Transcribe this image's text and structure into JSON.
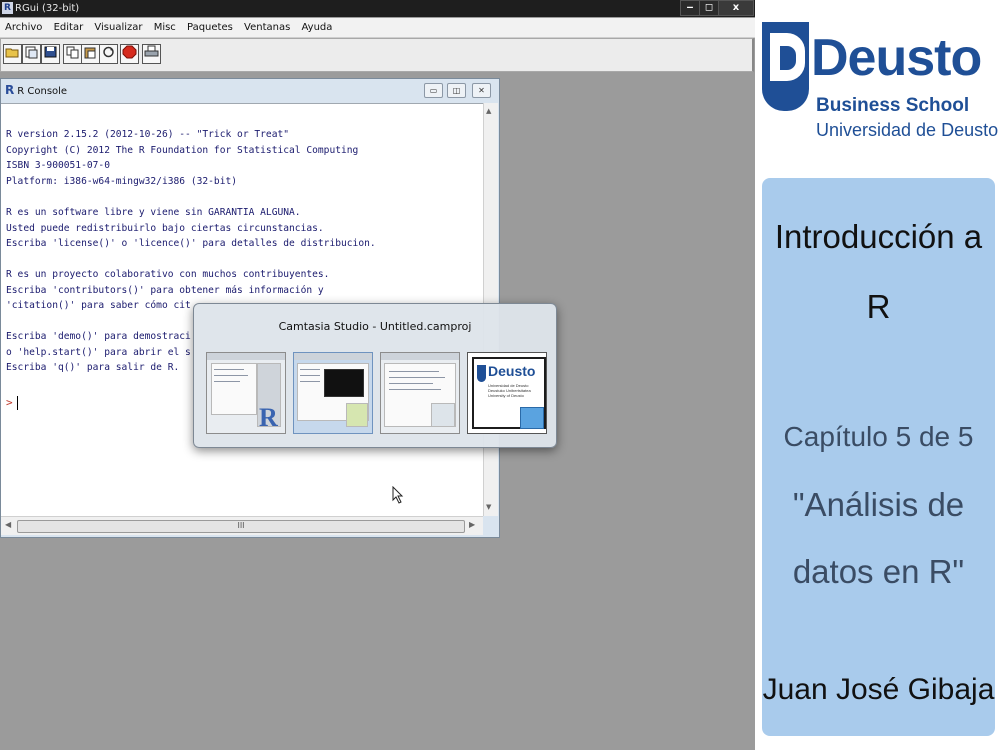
{
  "window": {
    "title": "RGui (32-bit)",
    "controls": [
      "‒",
      "◻",
      "x"
    ]
  },
  "menubar": {
    "items": [
      "Archivo",
      "Editar",
      "Visualizar",
      "Misc",
      "Paquetes",
      "Ventanas",
      "Ayuda"
    ]
  },
  "toolbar": {
    "buttons": [
      "open-script-icon",
      "load-workspace-icon",
      "save-workspace-icon",
      "copy-icon",
      "paste-icon",
      "copy-paste-icon",
      "stop-icon",
      "print-icon"
    ]
  },
  "console": {
    "title": "R Console",
    "lines_block1": "R version 2.15.2 (2012-10-26) -- \"Trick or Treat\"\nCopyright (C) 2012 The R Foundation for Statistical Computing\nISBN 3-900051-07-0\nPlatform: i386-w64-mingw32/i386 (32-bit)",
    "lines_block2": "R es un software libre y viene sin GARANTIA ALGUNA.\nUsted puede redistribuirlo bajo ciertas circunstancias.\nEscriba 'license()' o 'licence()' para detalles de distribucion.",
    "lines_block3": "R es un proyecto colaborativo con muchos contribuyentes.\nEscriba 'contributors()' para obtener más información y\n'citation()' para saber cómo cit",
    "lines_block4": "Escriba 'demo()' para demostraci\no 'help.start()' para abrir el s\nEscriba 'q()' para salir de R.",
    "prompt": ">",
    "hscroll_label": "III"
  },
  "switcher": {
    "title": "Camtasia Studio - Untitled.camproj",
    "thumbnail_labels": [
      "R",
      "",
      "",
      "Deusto"
    ],
    "deusto_thumb_caption": "Universidad de Deusto\nDeustuko Unibertsitatea\nUniversity of Deusto",
    "selected_index": 1
  },
  "slide": {
    "logo_word": "Deusto",
    "logo_school": "Business School",
    "logo_university": "Universidad de Deusto",
    "title_line1": "Introducción a",
    "title_line2": "R",
    "chapter": "Capítulo 5 de 5",
    "subtitle_line1": "\"Análisis de",
    "subtitle_line2": "datos en R\"",
    "author": "Juan José Gibaja"
  },
  "colors": {
    "deusto_blue": "#1f4f96",
    "card_blue": "#a9cbec",
    "console_text": "#1b1b6e",
    "prompt_red": "#c0392b"
  }
}
